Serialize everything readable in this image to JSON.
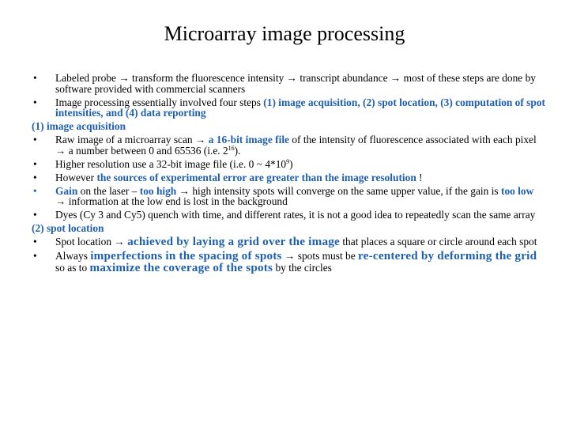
{
  "title": "Microarray image processing",
  "arrow_glyph": "→",
  "bullet_glyph": "•",
  "accent_color": "#1f5fb0",
  "intro": [
    {
      "segments": [
        {
          "t": "Labeled probe ",
          "s": "n"
        },
        {
          "t": "→",
          "s": "a"
        },
        {
          "t": " transform the fluorescence intensity ",
          "s": "n"
        },
        {
          "t": "→",
          "s": "a"
        },
        {
          "t": " transcript abundance ",
          "s": "n"
        },
        {
          "t": "→",
          "s": "a"
        },
        {
          "t": " most of these steps are done by software provided with commercial scanners",
          "s": "n"
        }
      ]
    },
    {
      "segments": [
        {
          "t": "Image processing essentially involved four steps ",
          "s": "n"
        },
        {
          "t": "(1) image acquisition, (2) spot location, (3) computation of spot intensities, and (4) data reporting",
          "s": "b"
        }
      ]
    }
  ],
  "sections": [
    {
      "heading": "(1) image acquisition",
      "items": [
        {
          "segments": [
            {
              "t": "Raw image of a microarray scan ",
              "s": "n"
            },
            {
              "t": "→",
              "s": "a"
            },
            {
              "t": " ",
              "s": "n"
            },
            {
              "t": "a 16-bit image file",
              "s": "b"
            },
            {
              "t": " of the intensity of fluorescence associated with each pixel ",
              "s": "n"
            },
            {
              "t": "→",
              "s": "a"
            },
            {
              "t": " a number between 0 and 65536 (i.e. 2",
              "s": "n"
            },
            {
              "t": "16",
              "s": "sup"
            },
            {
              "t": ").",
              "s": "n"
            }
          ]
        },
        {
          "segments": [
            {
              "t": "Higher resolution use a 32-bit image file (i.e. 0 ~ 4*10",
              "s": "n"
            },
            {
              "t": "9",
              "s": "sup"
            },
            {
              "t": ")",
              "s": "n"
            }
          ]
        },
        {
          "segments": [
            {
              "t": "However ",
              "s": "n"
            },
            {
              "t": "the sources of experimental error are greater than the image resolution",
              "s": "b"
            },
            {
              "t": " !",
              "s": "n"
            }
          ]
        },
        {
          "blue_bullet": true,
          "segments": [
            {
              "t": "Gain",
              "s": "b"
            },
            {
              "t": " on the laser – ",
              "s": "n"
            },
            {
              "t": "too high",
              "s": "b"
            },
            {
              "t": " ",
              "s": "n"
            },
            {
              "t": "→",
              "s": "a"
            },
            {
              "t": " high intensity spots will converge on the same upper value, if the gain is ",
              "s": "n"
            },
            {
              "t": "too low",
              "s": "b"
            },
            {
              "t": " ",
              "s": "n"
            },
            {
              "t": "→",
              "s": "a"
            },
            {
              "t": " information at the low end is lost in the background",
              "s": "n"
            }
          ]
        },
        {
          "segments": [
            {
              "t": "Dyes (Cy 3 and Cy5) quench with time, and different rates, it is not a good idea to repeatedly scan the same array",
              "s": "n"
            }
          ]
        }
      ]
    },
    {
      "heading": "(2) spot location",
      "items": [
        {
          "segments": [
            {
              "t": "Spot location ",
              "s": "n"
            },
            {
              "t": "→",
              "s": "a"
            },
            {
              "t": " ",
              "s": "n"
            },
            {
              "t": "achieved by laying a grid over the image",
              "s": "bb"
            },
            {
              "t": " that places a square or circle around each spot",
              "s": "n"
            }
          ]
        },
        {
          "tall": true,
          "segments": [
            {
              "t": "Always ",
              "s": "n"
            },
            {
              "t": "imperfections in the spacing of spots",
              "s": "bb"
            },
            {
              "t": " ",
              "s": "n"
            },
            {
              "t": "→",
              "s": "a"
            },
            {
              "t": " spots must be ",
              "s": "n"
            },
            {
              "t": "re-centered by deforming the grid",
              "s": "bb"
            },
            {
              "t": " so as to ",
              "s": "n"
            },
            {
              "t": "maximize the coverage of the spots",
              "s": "bb"
            },
            {
              "t": " by the circles",
              "s": "n"
            }
          ]
        }
      ]
    }
  ]
}
